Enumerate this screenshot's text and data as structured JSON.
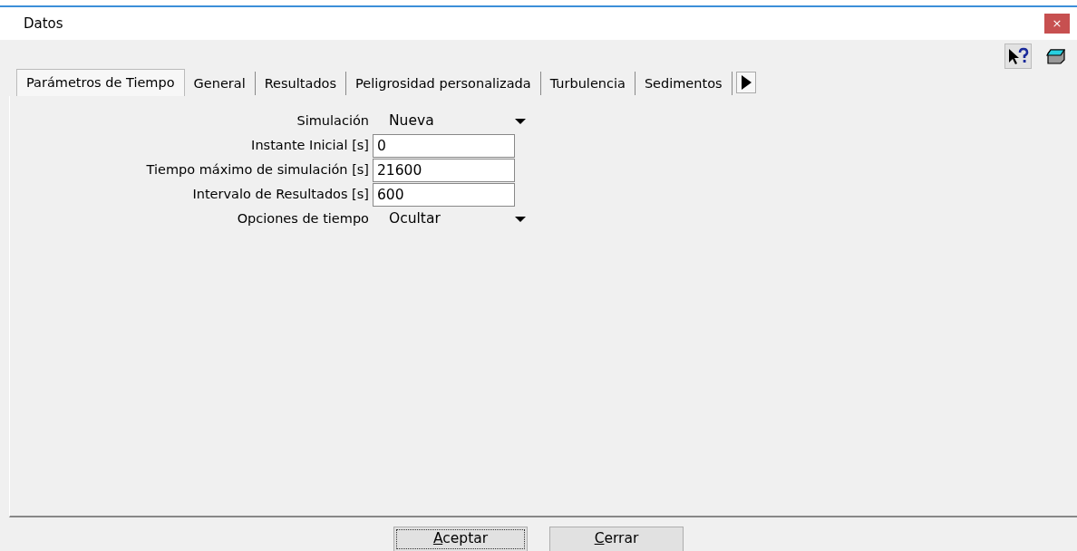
{
  "window": {
    "title": "Datos",
    "close_glyph": "×"
  },
  "toolbar": [
    {
      "kind": "help",
      "pressed": true
    },
    {
      "kind": "eraser",
      "pressed": false
    }
  ],
  "tabs": [
    {
      "label": "Parámetros de Tiempo",
      "selected": true
    },
    {
      "label": "General",
      "selected": false
    },
    {
      "label": "Resultados",
      "selected": false
    },
    {
      "label": "Peligrosidad personalizada",
      "selected": false
    },
    {
      "label": "Turbulencia",
      "selected": false
    },
    {
      "label": "Sedimentos",
      "selected": false
    }
  ],
  "fields": [
    {
      "kind": "dropdown",
      "label": "Simulación",
      "value": "Nueva"
    },
    {
      "kind": "input",
      "label": "Instante Inicial [s]",
      "value": "0"
    },
    {
      "kind": "input",
      "label": "Tiempo máximo de simulación [s]",
      "value": "21600"
    },
    {
      "kind": "input",
      "label": "Intervalo de Resultados [s]",
      "value": "600"
    },
    {
      "kind": "dropdown",
      "label": "Opciones de tiempo",
      "value": "Ocultar"
    }
  ],
  "buttons": [
    {
      "label": "Aceptar",
      "focused": true,
      "underline_first": true
    },
    {
      "label": "Cerrar",
      "focused": false,
      "underline_first": true
    }
  ]
}
